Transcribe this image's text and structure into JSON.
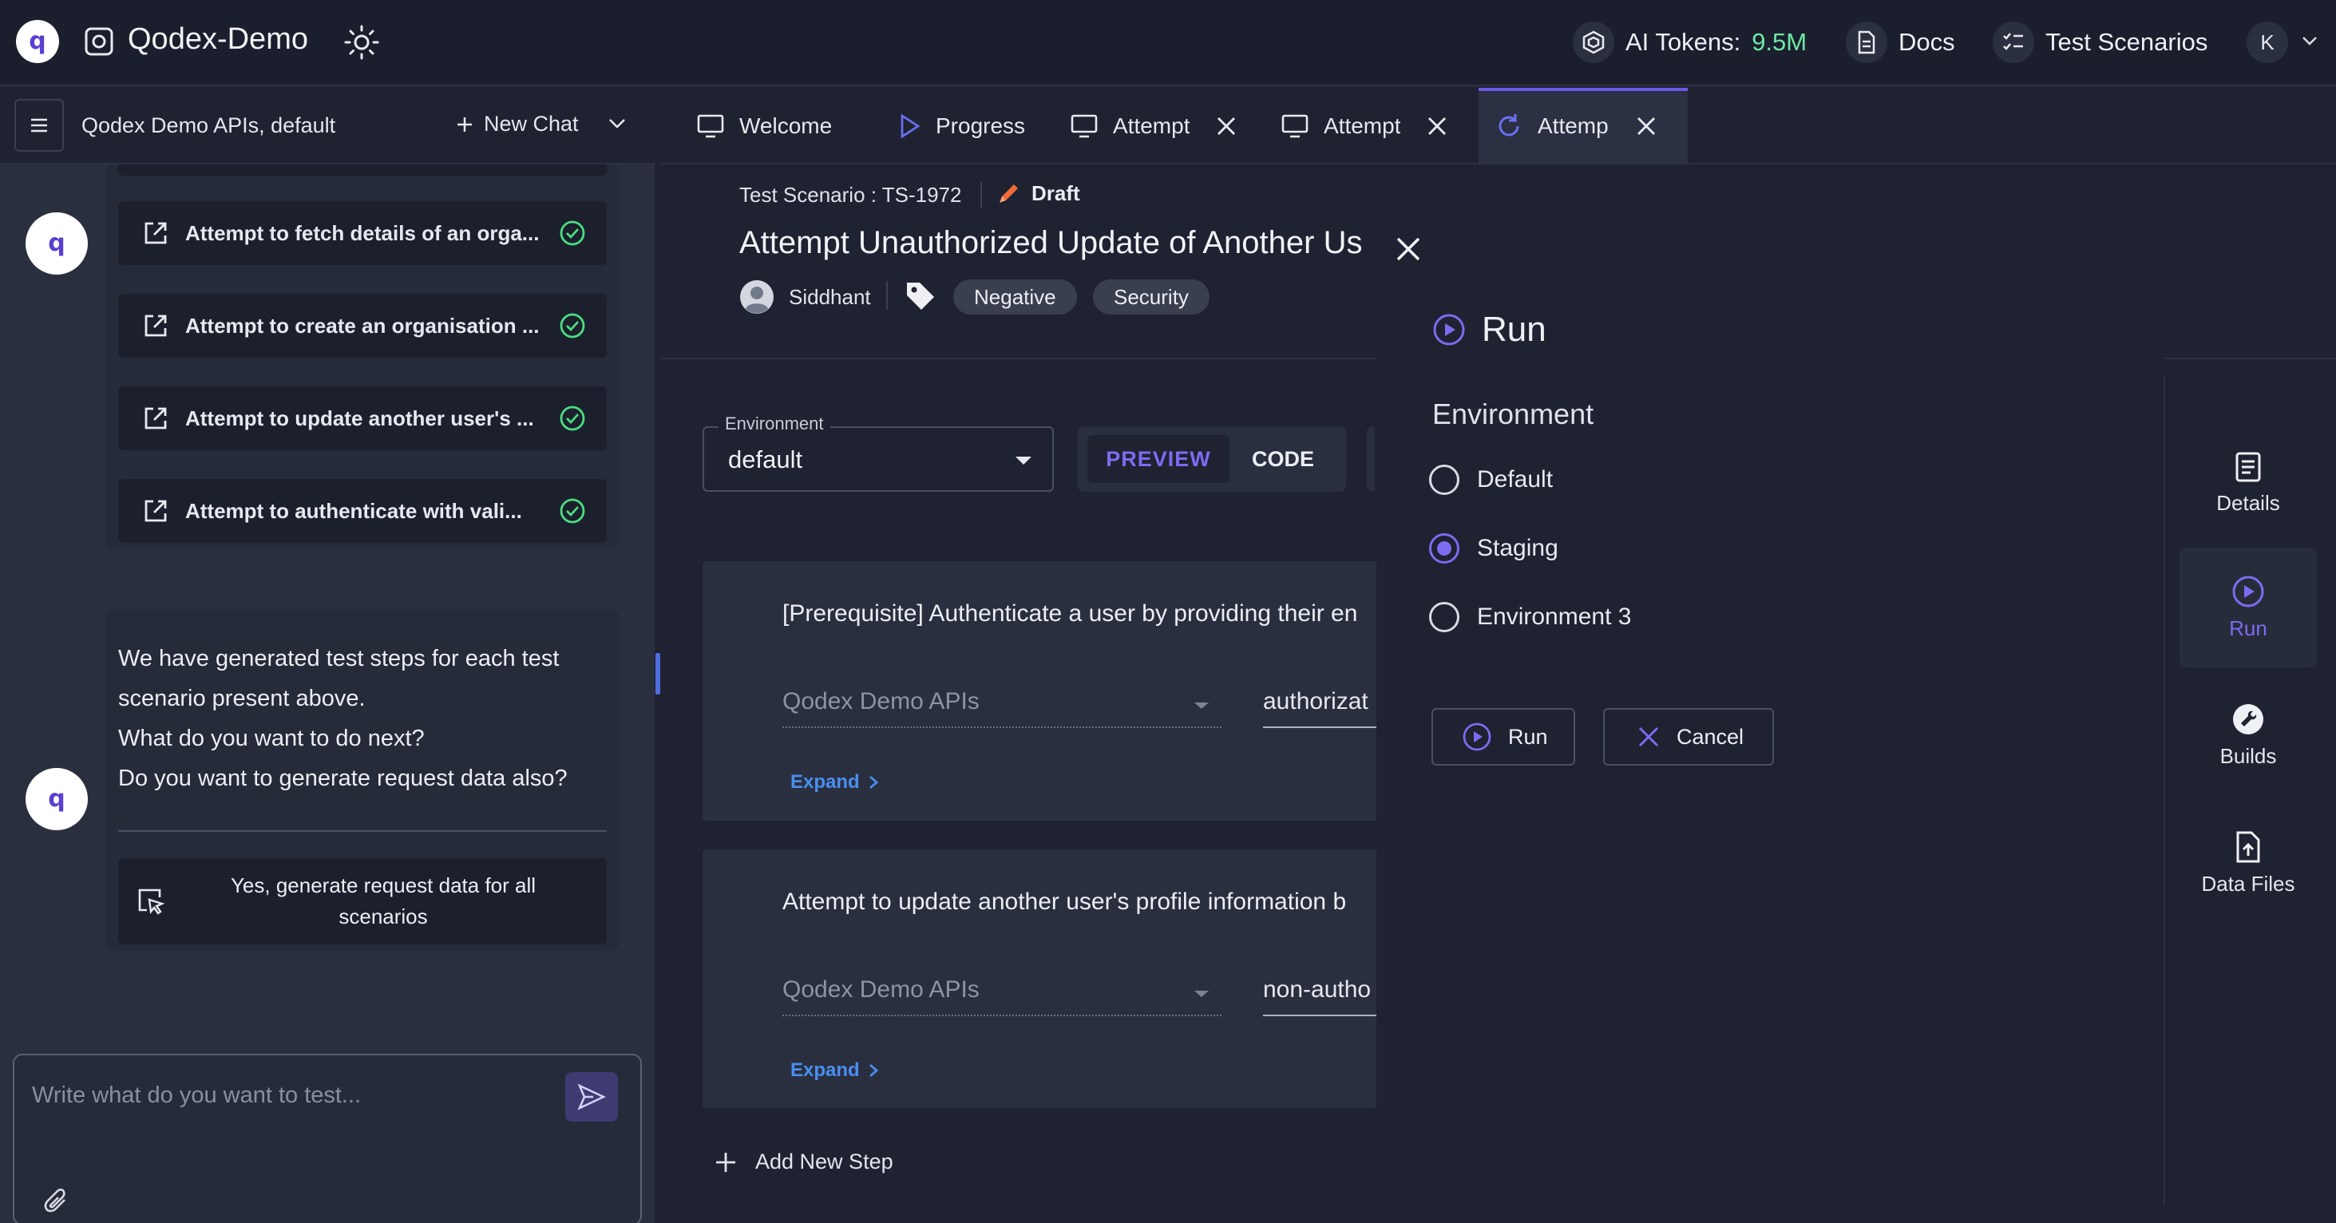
{
  "app": {
    "title": "Qodex-Demo",
    "tokens_label": "AI Tokens:",
    "tokens_value": "9.5M",
    "docs_label": "Docs",
    "test_scenarios_label": "Test Scenarios",
    "user_initial": "K"
  },
  "chat": {
    "context_label": "Qodex Demo APIs, default",
    "new_chat_label": "New Chat",
    "scenarios": [
      {
        "label": "Attempt to fetch details of an orga..."
      },
      {
        "label": "Attempt to create an organisation ..."
      },
      {
        "label": "Attempt to update another user's ..."
      },
      {
        "label": "Attempt to authenticate with vali..."
      }
    ],
    "bot_message": [
      "We have generated test steps for each test",
      "scenario present above.",
      "What do you want to do next?",
      "Do you want to generate request data also?"
    ],
    "suggestion": "Yes, generate request data for all scenarios",
    "input_placeholder": "Write what do you want to test..."
  },
  "tabs": [
    {
      "label": "Welcome",
      "icon": "monitor-icon"
    },
    {
      "label": "Progress",
      "icon": "play-icon"
    },
    {
      "label": "Attempt",
      "icon": "monitor-icon"
    },
    {
      "label": "Attempt",
      "icon": "monitor-icon"
    },
    {
      "label": "Attemp",
      "icon": "refresh-icon",
      "active": true
    }
  ],
  "scenario": {
    "id_label": "Test Scenario : TS-1972",
    "status": "Draft",
    "title": "Attempt Unauthorized Update of Another Us",
    "owner": "Siddhant",
    "tags": [
      "Negative",
      "Security"
    ],
    "environment_legend": "Environment",
    "environment_value": "default",
    "view_preview": "PREVIEW",
    "view_code": "CODE",
    "steps": [
      {
        "title": "[Prerequisite] Authenticate a user by providing their en",
        "api": "Qodex Demo APIs",
        "endpoint": "authorizat",
        "expand": "Expand"
      },
      {
        "title": "Attempt to update another user's profile information b",
        "api": "Qodex Demo APIs",
        "endpoint": "non-autho",
        "expand": "Expand"
      }
    ],
    "add_step": "Add New Step"
  },
  "run_drawer": {
    "title": "Run",
    "env_heading": "Environment",
    "options": [
      {
        "label": "Default",
        "checked": false
      },
      {
        "label": "Staging",
        "checked": true
      },
      {
        "label": "Environment 3",
        "checked": false
      }
    ],
    "run_button": "Run",
    "cancel_button": "Cancel"
  },
  "rail": [
    {
      "label": "Details",
      "icon": "document-icon"
    },
    {
      "label": "Run",
      "icon": "play-circle-icon",
      "active": true
    },
    {
      "label": "Builds",
      "icon": "wrench-icon"
    },
    {
      "label": "Data Files",
      "icon": "file-upload-icon"
    }
  ],
  "colors": {
    "accent": "#7c6cf0",
    "success": "#4ade80",
    "tokens": "#6ee7a6",
    "link": "#4a8ff0",
    "draft_pencil": "#f26b3a"
  }
}
